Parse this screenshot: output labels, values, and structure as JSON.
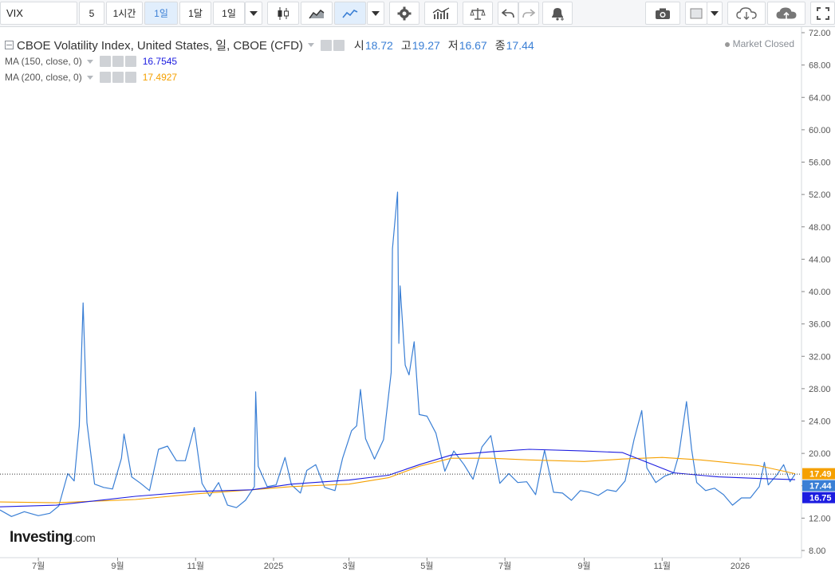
{
  "toolbar": {
    "symbol": "VIX",
    "intervals": [
      "5",
      "1시간",
      "1일",
      "1달",
      "1일"
    ],
    "active_interval_index": 2
  },
  "legend": {
    "title": "CBOE Volatility Index, United States, 일, CBOE (CFD)",
    "ohlc": [
      {
        "label": "시",
        "value": "18.72"
      },
      {
        "label": "고",
        "value": "19.27"
      },
      {
        "label": "저",
        "value": "16.67"
      },
      {
        "label": "종",
        "value": "17.44"
      }
    ],
    "ma150": {
      "label": "MA (150, close, 0)",
      "value": "16.7545",
      "color": "#1c1ce0"
    },
    "ma200": {
      "label": "MA (200, close, 0)",
      "value": "17.4927",
      "color": "#f5a000"
    },
    "market_status": "Market Closed"
  },
  "logo": {
    "brand": "Investing",
    "suffix": ".com"
  },
  "chart_data": {
    "type": "line",
    "ylim": [
      8,
      72
    ],
    "y_ticks": [
      8,
      12,
      16,
      20,
      24,
      28,
      32,
      36,
      40,
      44,
      48,
      52,
      56,
      60,
      64,
      68,
      72
    ],
    "y_tick_labels": [
      "8.00",
      "12.00",
      "16.00",
      "20.00",
      "24.00",
      "28.00",
      "32.00",
      "36.00",
      "40.00",
      "44.00",
      "48.00",
      "52.00",
      "56.00",
      "60.00",
      "64.00",
      "68.00",
      "72.00"
    ],
    "x_tick_labels": [
      "7월",
      "9월",
      "11월",
      "2025",
      "3월",
      "5월",
      "7월",
      "9월",
      "11월",
      "2026"
    ],
    "x_tick_dates": [
      "2024-07-01",
      "2024-09-01",
      "2024-11-01",
      "2025-01-01",
      "2025-03-01",
      "2025-05-01",
      "2025-07-01",
      "2025-09-01",
      "2025-11-01",
      "2026-01-01"
    ],
    "x_range": [
      "2024-06-01",
      "2026-02-13"
    ],
    "grid": false,
    "last_price_line": 17.44,
    "price_tags": [
      {
        "value": "17.49",
        "color": "#f5a000"
      },
      {
        "value": "17.44",
        "color": "#3a7fd5"
      },
      {
        "value": "16.75",
        "color": "#1c1ce0"
      }
    ],
    "series": [
      {
        "name": "VIX",
        "color": "#3a7fd5",
        "points": [
          [
            "2024-06-01",
            13.0
          ],
          [
            "2024-06-10",
            12.2
          ],
          [
            "2024-06-20",
            12.8
          ],
          [
            "2024-07-01",
            12.3
          ],
          [
            "2024-07-10",
            12.6
          ],
          [
            "2024-07-17",
            13.5
          ],
          [
            "2024-07-24",
            17.5
          ],
          [
            "2024-07-29",
            16.6
          ],
          [
            "2024-08-02",
            23.4
          ],
          [
            "2024-08-05",
            38.6
          ],
          [
            "2024-08-08",
            23.8
          ],
          [
            "2024-08-14",
            16.2
          ],
          [
            "2024-08-21",
            15.8
          ],
          [
            "2024-08-28",
            15.6
          ],
          [
            "2024-09-04",
            19.4
          ],
          [
            "2024-09-06",
            22.4
          ],
          [
            "2024-09-12",
            17.1
          ],
          [
            "2024-09-19",
            16.3
          ],
          [
            "2024-09-26",
            15.4
          ],
          [
            "2024-10-03",
            20.5
          ],
          [
            "2024-10-10",
            20.9
          ],
          [
            "2024-10-17",
            19.1
          ],
          [
            "2024-10-24",
            19.1
          ],
          [
            "2024-10-31",
            23.2
          ],
          [
            "2024-11-06",
            16.3
          ],
          [
            "2024-11-12",
            14.7
          ],
          [
            "2024-11-19",
            16.4
          ],
          [
            "2024-11-26",
            13.6
          ],
          [
            "2024-12-03",
            13.3
          ],
          [
            "2024-12-10",
            14.2
          ],
          [
            "2024-12-17",
            15.9
          ],
          [
            "2024-12-18",
            27.6
          ],
          [
            "2024-12-20",
            18.4
          ],
          [
            "2024-12-27",
            15.9
          ],
          [
            "2025-01-03",
            16.1
          ],
          [
            "2025-01-10",
            19.5
          ],
          [
            "2025-01-15",
            16.1
          ],
          [
            "2025-01-22",
            15.1
          ],
          [
            "2025-01-27",
            17.9
          ],
          [
            "2025-02-03",
            18.6
          ],
          [
            "2025-02-10",
            15.8
          ],
          [
            "2025-02-18",
            15.4
          ],
          [
            "2025-02-24",
            19.4
          ],
          [
            "2025-03-03",
            22.8
          ],
          [
            "2025-03-07",
            23.4
          ],
          [
            "2025-03-10",
            27.9
          ],
          [
            "2025-03-14",
            21.8
          ],
          [
            "2025-03-21",
            19.3
          ],
          [
            "2025-03-28",
            21.7
          ],
          [
            "2025-04-03",
            30.0
          ],
          [
            "2025-04-04",
            45.3
          ],
          [
            "2025-04-08",
            52.3
          ],
          [
            "2025-04-09",
            33.6
          ],
          [
            "2025-04-10",
            40.7
          ],
          [
            "2025-04-14",
            30.9
          ],
          [
            "2025-04-17",
            29.7
          ],
          [
            "2025-04-21",
            33.8
          ],
          [
            "2025-04-25",
            24.8
          ],
          [
            "2025-05-01",
            24.6
          ],
          [
            "2025-05-08",
            22.5
          ],
          [
            "2025-05-15",
            17.8
          ],
          [
            "2025-05-22",
            20.3
          ],
          [
            "2025-05-30",
            18.6
          ],
          [
            "2025-06-06",
            16.8
          ],
          [
            "2025-06-13",
            20.8
          ],
          [
            "2025-06-20",
            22.2
          ],
          [
            "2025-06-27",
            16.3
          ],
          [
            "2025-07-04",
            17.5
          ],
          [
            "2025-07-11",
            16.4
          ],
          [
            "2025-07-18",
            16.5
          ],
          [
            "2025-07-25",
            14.9
          ],
          [
            "2025-08-01",
            20.4
          ],
          [
            "2025-08-08",
            15.2
          ],
          [
            "2025-08-15",
            15.1
          ],
          [
            "2025-08-22",
            14.2
          ],
          [
            "2025-08-29",
            15.4
          ],
          [
            "2025-09-05",
            15.2
          ],
          [
            "2025-09-12",
            14.8
          ],
          [
            "2025-09-19",
            15.5
          ],
          [
            "2025-09-26",
            15.3
          ],
          [
            "2025-10-03",
            16.6
          ],
          [
            "2025-10-10",
            21.7
          ],
          [
            "2025-10-16",
            25.3
          ],
          [
            "2025-10-20",
            18.2
          ],
          [
            "2025-10-27",
            16.4
          ],
          [
            "2025-11-03",
            17.2
          ],
          [
            "2025-11-10",
            17.6
          ],
          [
            "2025-11-14",
            19.8
          ],
          [
            "2025-11-20",
            26.4
          ],
          [
            "2025-11-24",
            20.5
          ],
          [
            "2025-11-28",
            16.4
          ],
          [
            "2025-12-05",
            15.4
          ],
          [
            "2025-12-12",
            15.7
          ],
          [
            "2025-12-19",
            14.9
          ],
          [
            "2025-12-26",
            13.6
          ],
          [
            "2026-01-02",
            14.5
          ],
          [
            "2026-01-09",
            14.5
          ],
          [
            "2026-01-16",
            15.9
          ],
          [
            "2026-01-20",
            18.9
          ],
          [
            "2026-01-23",
            16.1
          ],
          [
            "2026-01-30",
            17.4
          ],
          [
            "2026-02-04",
            18.6
          ],
          [
            "2026-02-09",
            16.5
          ],
          [
            "2026-02-13",
            17.44
          ]
        ]
      },
      {
        "name": "MA (150, close, 0)",
        "color": "#1c1ce0",
        "points": [
          [
            "2024-06-01",
            13.4
          ],
          [
            "2024-07-15",
            13.6
          ],
          [
            "2024-09-15",
            14.7
          ],
          [
            "2024-11-01",
            15.3
          ],
          [
            "2024-12-15",
            15.5
          ],
          [
            "2025-01-15",
            16.2
          ],
          [
            "2025-03-01",
            16.7
          ],
          [
            "2025-04-01",
            17.3
          ],
          [
            "2025-04-25",
            18.6
          ],
          [
            "2025-05-20",
            19.8
          ],
          [
            "2025-06-20",
            20.2
          ],
          [
            "2025-07-20",
            20.5
          ],
          [
            "2025-09-01",
            20.3
          ],
          [
            "2025-10-01",
            20.1
          ],
          [
            "2025-11-10",
            17.6
          ],
          [
            "2025-12-15",
            17.1
          ],
          [
            "2026-01-15",
            16.9
          ],
          [
            "2026-02-13",
            16.75
          ]
        ]
      },
      {
        "name": "MA (200, close, 0)",
        "color": "#f5a000",
        "points": [
          [
            "2024-06-01",
            14.0
          ],
          [
            "2024-07-15",
            13.9
          ],
          [
            "2024-09-15",
            14.3
          ],
          [
            "2024-11-01",
            15.0
          ],
          [
            "2024-12-15",
            15.5
          ],
          [
            "2025-01-15",
            15.9
          ],
          [
            "2025-03-01",
            16.2
          ],
          [
            "2025-04-01",
            17.0
          ],
          [
            "2025-04-25",
            18.4
          ],
          [
            "2025-05-20",
            19.4
          ],
          [
            "2025-06-20",
            19.4
          ],
          [
            "2025-07-20",
            19.2
          ],
          [
            "2025-09-01",
            19.0
          ],
          [
            "2025-10-01",
            19.3
          ],
          [
            "2025-11-01",
            19.5
          ],
          [
            "2025-12-01",
            19.2
          ],
          [
            "2026-01-15",
            18.5
          ],
          [
            "2026-02-13",
            17.49
          ]
        ]
      }
    ]
  }
}
